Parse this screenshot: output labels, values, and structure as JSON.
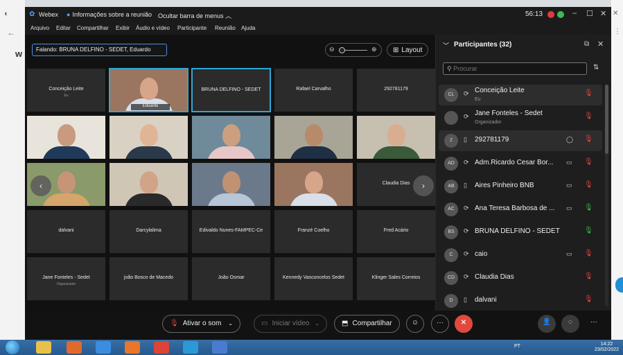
{
  "window": {
    "app_name": "Webex",
    "meeting_info": "Informações sobre a reunião",
    "hide_menu": "Ocultar barra de menus",
    "timer": "56:13"
  },
  "menu": [
    "Arquivo",
    "Editar",
    "Compartilhar",
    "Exibir",
    "Áudio e vídeo",
    "Participante",
    "Reunião",
    "Ajuda"
  ],
  "stage": {
    "speaking": "Falando: BRUNA DELFINO - SEDET, Eduardo",
    "layout_label": "Layout"
  },
  "tiles": [
    {
      "name": "Conceição Leite",
      "sub": "Eu",
      "kind": "name"
    },
    {
      "name": "",
      "caption": "Eduardo",
      "kind": "video",
      "active": true
    },
    {
      "name": "BRUNA DELFINO - SEDET",
      "kind": "name",
      "active": true
    },
    {
      "name": "Rafael Carvalho",
      "kind": "name"
    },
    {
      "name": "292781179",
      "kind": "name"
    },
    {
      "kind": "video"
    },
    {
      "kind": "video"
    },
    {
      "kind": "video"
    },
    {
      "kind": "video"
    },
    {
      "kind": "video"
    },
    {
      "kind": "video"
    },
    {
      "kind": "video"
    },
    {
      "kind": "video"
    },
    {
      "kind": "video"
    },
    {
      "name": "Claudia Dias",
      "kind": "name"
    },
    {
      "name": "dalvani",
      "kind": "name"
    },
    {
      "name": "Darcylalima",
      "kind": "name"
    },
    {
      "name": "Edivaldo Nunes-FAMPEC-Ce",
      "kind": "name"
    },
    {
      "name": "Franzé Coelho",
      "kind": "name"
    },
    {
      "name": "Fred Acário",
      "kind": "name"
    },
    {
      "name": "Jane Fonteles - Sedet",
      "sub": "Organizador",
      "kind": "name"
    },
    {
      "name": "joão Bosco de Macedo",
      "kind": "name"
    },
    {
      "name": "João Osmar",
      "kind": "name"
    },
    {
      "name": "Kennedy Vasconcelos Sedet",
      "kind": "name"
    },
    {
      "name": "Klinger Sales Correios",
      "kind": "name"
    }
  ],
  "controls": {
    "mute": "Ativar o som",
    "video": "Iniciar vídeo",
    "share": "Compartilhar"
  },
  "panel": {
    "title": "Participantes (32)",
    "search_placeholder": "Procurar",
    "participants": [
      {
        "initials": "CL",
        "name": "Conceição Leite",
        "role": "Eu",
        "device": "computer",
        "video": false,
        "muted": true,
        "highlight": true
      },
      {
        "initials": "",
        "name": "Jane Fonteles - Sedet",
        "role": "Organizador",
        "device": "computer",
        "video": false,
        "muted": true
      },
      {
        "initials": "2",
        "name": "292781179",
        "role": "",
        "device": "phone",
        "video": false,
        "chat": true,
        "muted": true,
        "highlight": true
      },
      {
        "initials": "AD",
        "name": "Adm.Ricardo Cesar Bor...",
        "role": "",
        "device": "computer",
        "video": true,
        "muted": true
      },
      {
        "initials": "AB",
        "name": "Aires Pinheiro BNB",
        "role": "",
        "device": "phone",
        "video": true,
        "muted": true
      },
      {
        "initials": "AC",
        "name": "Ana Teresa Barbosa de ...",
        "role": "",
        "device": "computer",
        "video": true,
        "muted": false
      },
      {
        "initials": "BS",
        "name": "BRUNA DELFINO - SEDET",
        "role": "",
        "device": "computer",
        "video": false,
        "muted": false
      },
      {
        "initials": "C",
        "name": "caio",
        "role": "",
        "device": "computer",
        "video": true,
        "muted": true
      },
      {
        "initials": "CD",
        "name": "Claudia Dias",
        "role": "",
        "device": "computer",
        "video": false,
        "muted": true
      },
      {
        "initials": "D",
        "name": "dalvani",
        "role": "",
        "device": "phone",
        "video": false,
        "muted": true
      }
    ]
  },
  "taskbar": {
    "lang": "PT",
    "time": "14:22",
    "date": "23/02/2022"
  },
  "colors": {
    "accent": "#2fa8d8",
    "end_call": "#e2483d",
    "unmuted": "#3fb950"
  }
}
